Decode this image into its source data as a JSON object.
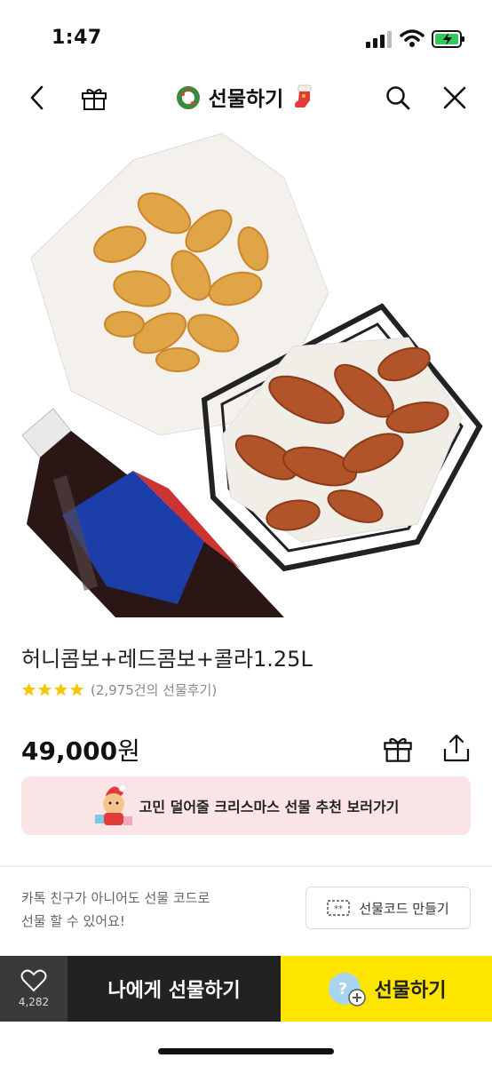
{
  "status_bar": {
    "time": "1:47"
  },
  "nav": {
    "title": "선물하기",
    "icons": [
      "back-icon",
      "gift-box-icon",
      "wreath-icon",
      "stocking-icon",
      "search-icon",
      "close-icon"
    ]
  },
  "product": {
    "image_alt": "honey combo, red combo fried chicken with cola",
    "title": "허니콤보+레드콤보+콜라1.25L",
    "stars": 4,
    "review_text": "(2,975건의 선물후기)",
    "price_amount": "49,000",
    "price_unit": "원"
  },
  "banner": {
    "text": "고민 덜어줄 크리스마스 선물 추천 보러가기"
  },
  "gift_code": {
    "info_line1": "카톡 친구가 아니어도 선물 코드로",
    "info_line2": "선물 할 수 있어요!",
    "button_label": "선물코드 만들기"
  },
  "bottom_bar": {
    "like_count": "4,282",
    "self_gift_label": "나에게 선물하기",
    "gift_label": "선물하기"
  },
  "colors": {
    "accent_yellow": "#fee500",
    "dark_button": "#222222",
    "banner_pink": "#fbe4e6",
    "star": "#f7c600"
  }
}
